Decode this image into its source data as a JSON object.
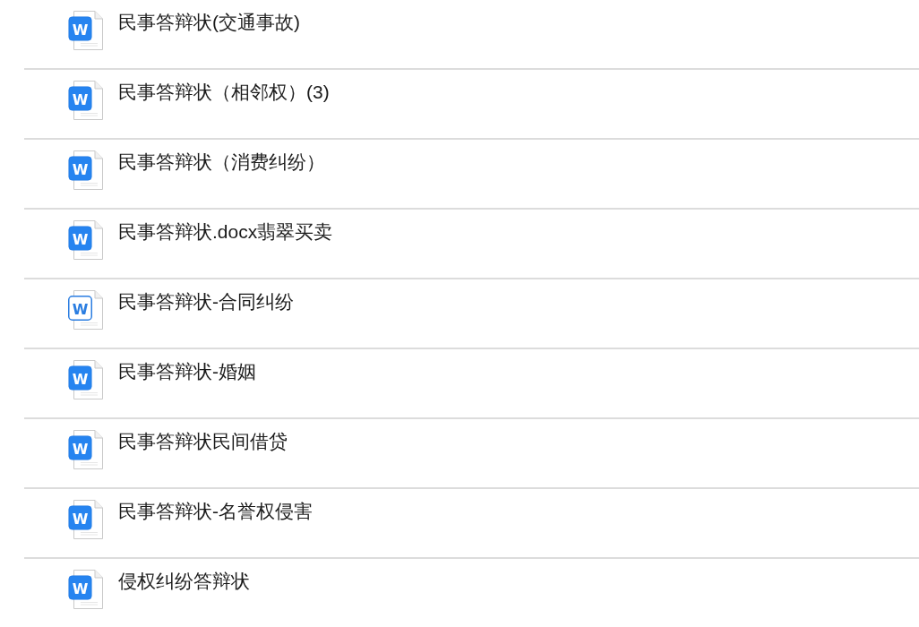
{
  "files": [
    {
      "name": "民事答辩状(交通事故)",
      "kind": "filled",
      "icon_letter": "W"
    },
    {
      "name": "民事答辩状（相邻权）(3)",
      "kind": "filled",
      "icon_letter": "W"
    },
    {
      "name": "民事答辩状（消费纠纷）",
      "kind": "filled",
      "icon_letter": "W"
    },
    {
      "name": "民事答辩状.docx翡翠买卖",
      "kind": "filled",
      "icon_letter": "W"
    },
    {
      "name": "民事答辩状-合同纠纷",
      "kind": "outline",
      "icon_letter": "W"
    },
    {
      "name": "民事答辩状-婚姻",
      "kind": "filled",
      "icon_letter": "W"
    },
    {
      "name": "民事答辩状民间借贷",
      "kind": "filled",
      "icon_letter": "W"
    },
    {
      "name": "民事答辩状-名誉权侵害",
      "kind": "filled",
      "icon_letter": "W"
    },
    {
      "name": "侵权纠纷答辩状",
      "kind": "filled",
      "icon_letter": "W"
    }
  ]
}
